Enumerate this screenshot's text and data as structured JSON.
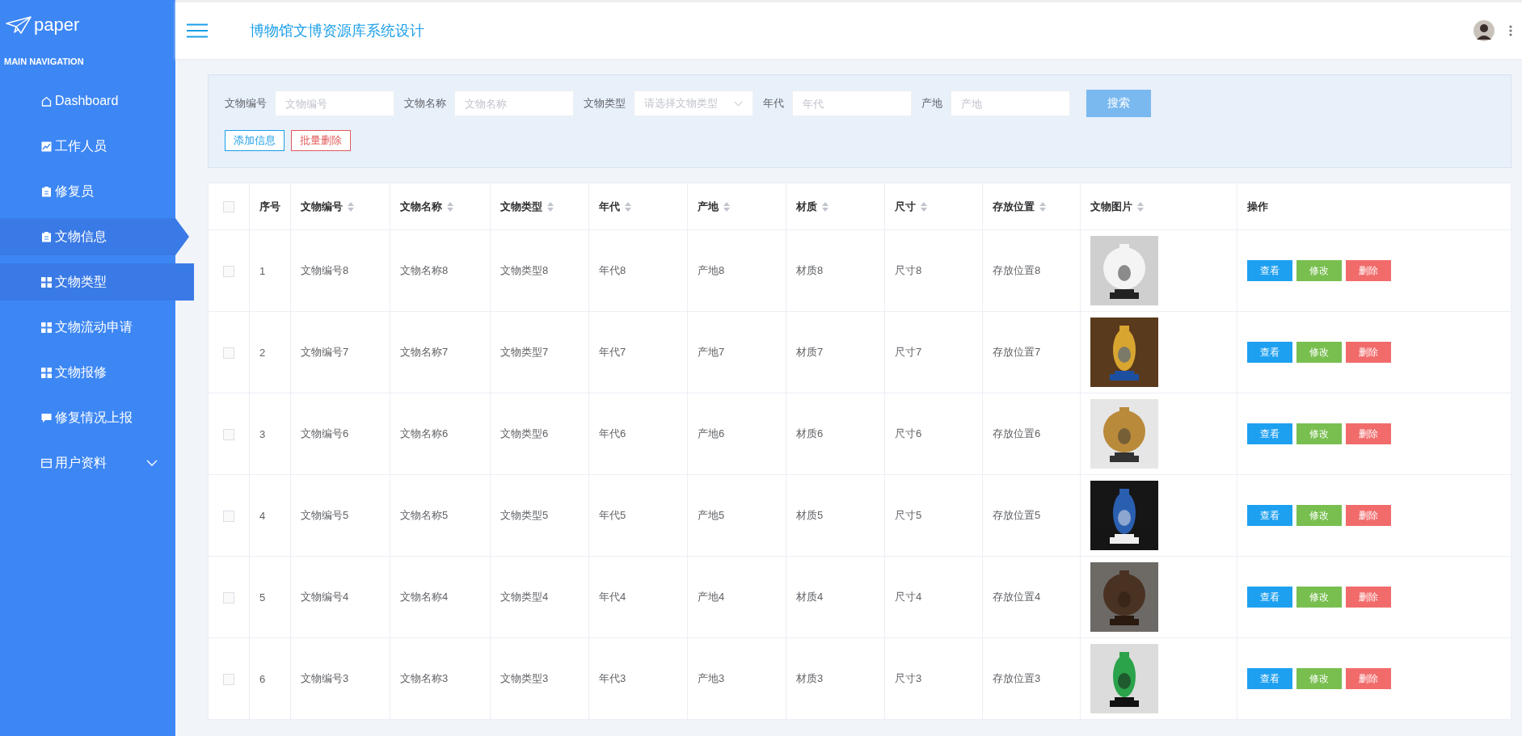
{
  "sidebar": {
    "logo": "paper",
    "heading": "MAIN NAVIGATION",
    "items": [
      {
        "label": "Dashboard",
        "selected": false,
        "highlighted": false,
        "submenu": false
      },
      {
        "label": "工作人员",
        "selected": false,
        "highlighted": false,
        "submenu": false
      },
      {
        "label": "修复员",
        "selected": false,
        "highlighted": false,
        "submenu": false
      },
      {
        "label": "文物信息",
        "selected": true,
        "highlighted": false,
        "submenu": false
      },
      {
        "label": "文物类型",
        "selected": false,
        "highlighted": true,
        "submenu": false
      },
      {
        "label": "文物流动申请",
        "selected": false,
        "highlighted": false,
        "submenu": false
      },
      {
        "label": "文物报修",
        "selected": false,
        "highlighted": false,
        "submenu": false
      },
      {
        "label": "修复情况上报",
        "selected": false,
        "highlighted": false,
        "submenu": false
      },
      {
        "label": "用户资料",
        "selected": false,
        "highlighted": false,
        "submenu": true
      }
    ]
  },
  "header": {
    "title": "博物馆文博资源库系统设计"
  },
  "search": {
    "fields": [
      {
        "label": "文物编号",
        "placeholder": "文物编号",
        "kind": "text"
      },
      {
        "label": "文物名称",
        "placeholder": "文物名称",
        "kind": "text"
      },
      {
        "label": "文物类型",
        "placeholder": "请选择文物类型",
        "kind": "select"
      },
      {
        "label": "年代",
        "placeholder": "年代",
        "kind": "text"
      },
      {
        "label": "产地",
        "placeholder": "产地",
        "kind": "text"
      }
    ],
    "button": "搜索",
    "actions": [
      {
        "label": "添加信息",
        "kind": "add"
      },
      {
        "label": "批量删除",
        "kind": "delete"
      }
    ]
  },
  "table": {
    "all_checked": false,
    "columns": [
      {
        "label": "序号",
        "sortable": false
      },
      {
        "label": "文物编号",
        "sortable": true
      },
      {
        "label": "文物名称",
        "sortable": true
      },
      {
        "label": "文物类型",
        "sortable": true
      },
      {
        "label": "年代",
        "sortable": true
      },
      {
        "label": "产地",
        "sortable": true
      },
      {
        "label": "材质",
        "sortable": true
      },
      {
        "label": "尺寸",
        "sortable": true
      },
      {
        "label": "存放位置",
        "sortable": true
      },
      {
        "label": "文物图片",
        "sortable": true
      },
      {
        "label": "操作",
        "sortable": false
      }
    ],
    "rows": [
      {
        "checked": false,
        "cells": [
          "1",
          "文物编号8",
          "文物名称8",
          "文物类型8",
          "年代8",
          "产地8",
          "材质8",
          "尺寸8",
          "存放位置8"
        ],
        "buttons": [
          {
            "label": "查看",
            "kind": "view"
          },
          {
            "label": "修改",
            "kind": "edit"
          },
          {
            "label": "删除",
            "kind": "delete"
          }
        ]
      },
      {
        "checked": false,
        "cells": [
          "2",
          "文物编号7",
          "文物名称7",
          "文物类型7",
          "年代7",
          "产地7",
          "材质7",
          "尺寸7",
          "存放位置7"
        ],
        "buttons": [
          {
            "label": "查看",
            "kind": "view"
          },
          {
            "label": "修改",
            "kind": "edit"
          },
          {
            "label": "删除",
            "kind": "delete"
          }
        ]
      },
      {
        "checked": false,
        "cells": [
          "3",
          "文物编号6",
          "文物名称6",
          "文物类型6",
          "年代6",
          "产地6",
          "材质6",
          "尺寸6",
          "存放位置6"
        ],
        "buttons": [
          {
            "label": "查看",
            "kind": "view"
          },
          {
            "label": "修改",
            "kind": "edit"
          },
          {
            "label": "删除",
            "kind": "delete"
          }
        ]
      },
      {
        "checked": false,
        "cells": [
          "4",
          "文物编号5",
          "文物名称5",
          "文物类型5",
          "年代5",
          "产地5",
          "材质5",
          "尺寸5",
          "存放位置5"
        ],
        "buttons": [
          {
            "label": "查看",
            "kind": "view"
          },
          {
            "label": "修改",
            "kind": "edit"
          },
          {
            "label": "删除",
            "kind": "delete"
          }
        ]
      },
      {
        "checked": false,
        "cells": [
          "5",
          "文物编号4",
          "文物名称4",
          "文物类型4",
          "年代4",
          "产地4",
          "材质4",
          "尺寸4",
          "存放位置4"
        ],
        "buttons": [
          {
            "label": "查看",
            "kind": "view"
          },
          {
            "label": "修改",
            "kind": "edit"
          },
          {
            "label": "删除",
            "kind": "delete"
          }
        ]
      },
      {
        "checked": false,
        "cells": [
          "6",
          "文物编号3",
          "文物名称3",
          "文物类型3",
          "年代3",
          "产地3",
          "材质3",
          "尺寸3",
          "存放位置3"
        ],
        "buttons": [
          {
            "label": "查看",
            "kind": "view"
          },
          {
            "label": "修改",
            "kind": "edit"
          },
          {
            "label": "删除",
            "kind": "delete"
          }
        ]
      }
    ]
  }
}
